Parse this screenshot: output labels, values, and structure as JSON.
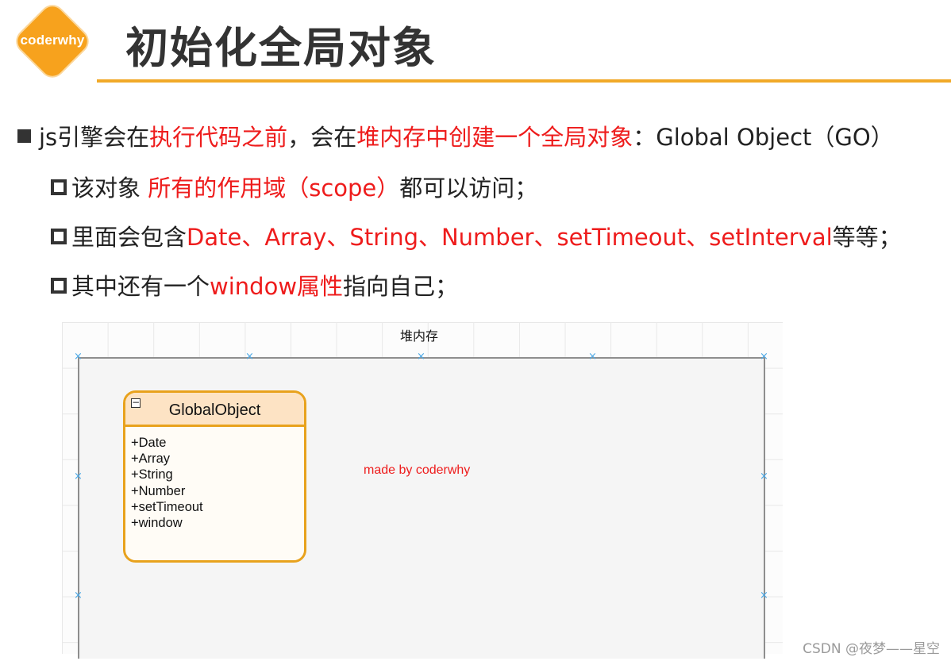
{
  "logo": {
    "text": "coderwhy"
  },
  "title": "初始化全局对象",
  "bullets": {
    "main": [
      {
        "text": "js引擎会在",
        "red": false
      },
      {
        "text": "执行代码之前",
        "red": true
      },
      {
        "text": "，会在",
        "red": false
      },
      {
        "text": "堆内存中创建一个全局对象",
        "red": true
      },
      {
        "text": "：Global Object（GO）",
        "red": false
      }
    ],
    "sub1": [
      {
        "text": "该对象 ",
        "red": false
      },
      {
        "text": "所有的作用域（scope）",
        "red": true
      },
      {
        "text": "都可以访问；",
        "red": false
      }
    ],
    "sub2": [
      {
        "text": "里面会包含",
        "red": false
      },
      {
        "text": "Date、Array、String、Number、setTimeout、setInterval",
        "red": true
      },
      {
        "text": "等等；",
        "red": false
      }
    ],
    "sub3": [
      {
        "text": "其中还有一个",
        "red": false
      },
      {
        "text": "window属性",
        "red": true
      },
      {
        "text": "指向自己；",
        "red": false
      }
    ]
  },
  "diagram": {
    "container_label": "堆内存",
    "class_box": {
      "title": "GlobalObject",
      "members": [
        "+Date",
        "+Array",
        "+String",
        "+Number",
        "+setTimeout",
        "+window"
      ]
    },
    "annotation": "made by coderwhy"
  },
  "watermark": "CSDN @夜梦——星空",
  "colors": {
    "accent": "#f1a928",
    "highlight": "#ee1c1c",
    "uml_border": "#e8a21d",
    "uml_header": "#fde3c4"
  }
}
